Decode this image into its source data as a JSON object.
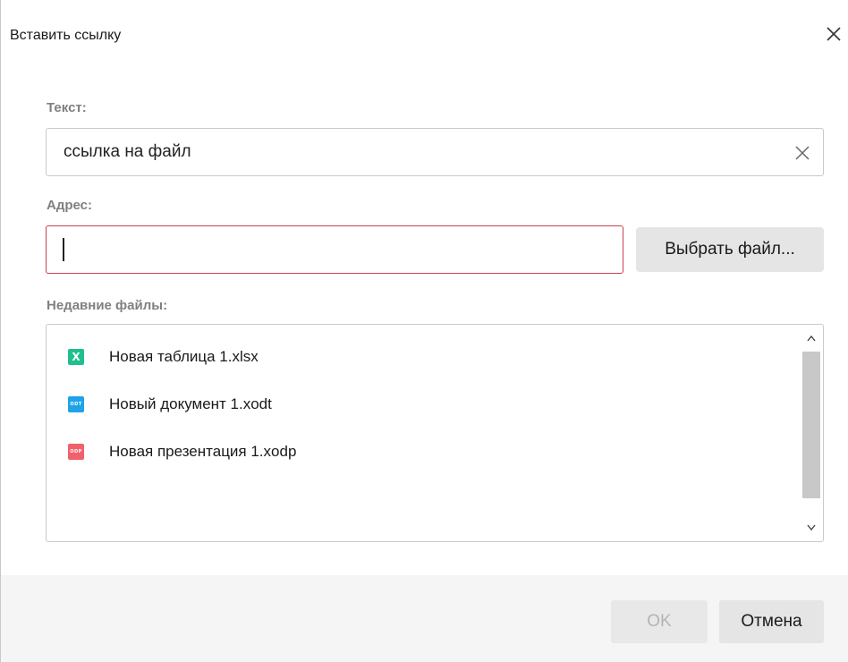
{
  "dialog": {
    "title": "Вставить ссылку"
  },
  "text_field": {
    "label": "Текст:",
    "value": "ссылка на файл"
  },
  "address_field": {
    "label": "Адрес:",
    "value": ""
  },
  "choose_file_button": {
    "label": "Выбрать файл..."
  },
  "recent_files": {
    "label": "Недавние файлы:",
    "items": [
      {
        "name": "Новая таблица 1.xlsx",
        "icon": "xlsx-file-icon",
        "icon_text": "X",
        "icon_color": "#1fbf8f"
      },
      {
        "name": "Новый документ 1.xodt",
        "icon": "xodt-file-icon",
        "icon_text": "ODT",
        "icon_color": "#1fa3e8"
      },
      {
        "name": "Новая презентация 1.xodp",
        "icon": "xodp-file-icon",
        "icon_text": "ODP",
        "icon_color": "#f0616c"
      }
    ]
  },
  "footer": {
    "ok_label": "OK",
    "cancel_label": "Отмена"
  },
  "colors": {
    "error_border": "#c8414b",
    "footer_bg": "#f5f5f5",
    "button_bg": "#e5e5e5",
    "disabled_text": "#b3b3b3"
  }
}
